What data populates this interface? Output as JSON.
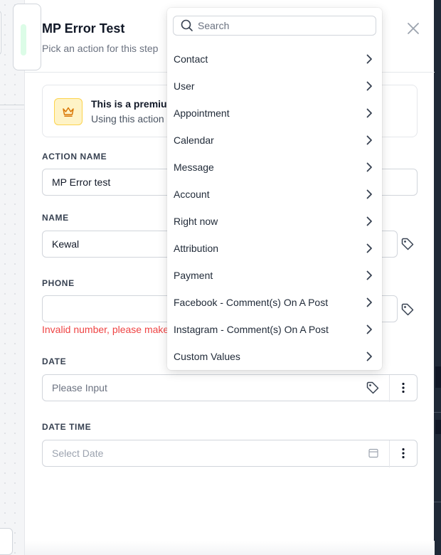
{
  "panel": {
    "title": "MP Error Test",
    "subtitle": "Pick an action for this step"
  },
  "premium": {
    "title": "This is a premiu",
    "description": "Using this action"
  },
  "fields": {
    "action_name": {
      "label": "ACTION NAME",
      "value": "MP Error test"
    },
    "name": {
      "label": "NAME",
      "value": "Kewal"
    },
    "phone": {
      "label": "PHONE",
      "value": "",
      "error": "Invalid number, please make"
    },
    "date": {
      "label": "DATE",
      "placeholder": "Please Input"
    },
    "date_time": {
      "label": "DATE TIME",
      "placeholder": "Select Date"
    }
  },
  "dropdown": {
    "search_placeholder": "Search",
    "items": [
      {
        "label": "Contact"
      },
      {
        "label": "User"
      },
      {
        "label": "Appointment"
      },
      {
        "label": "Calendar"
      },
      {
        "label": "Message"
      },
      {
        "label": "Account"
      },
      {
        "label": "Right now"
      },
      {
        "label": "Attribution"
      },
      {
        "label": "Payment"
      },
      {
        "label": "Facebook - Comment(s) On A Post"
      },
      {
        "label": "Instagram - Comment(s) On A Post"
      },
      {
        "label": "Custom Values"
      }
    ]
  },
  "icons": {
    "close": "close-icon",
    "crown": "crown-icon",
    "tag": "tag-icon",
    "calendar": "calendar-icon",
    "kebab": "kebab-icon",
    "search": "search-icon",
    "chevron": "chevron-right-icon"
  },
  "colors": {
    "error": "#ef4444",
    "premium_bg": "#fef3c7",
    "premium_border": "#fcd34d",
    "crown": "#d97706"
  }
}
